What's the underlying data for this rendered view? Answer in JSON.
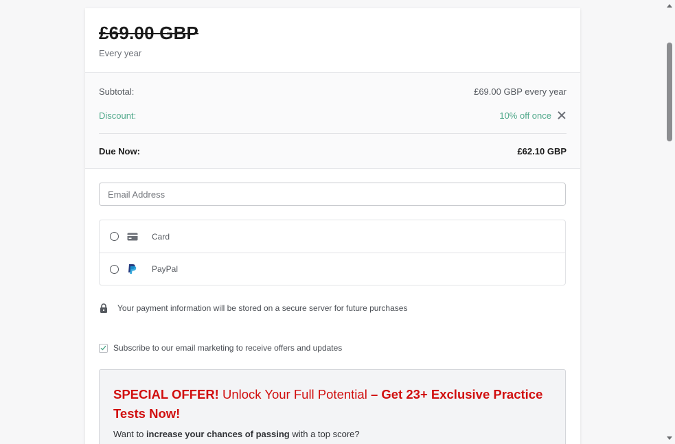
{
  "plan": {
    "old_price": "£69.00 GBP",
    "period": "Every year"
  },
  "summary": {
    "subtotal_label": "Subtotal:",
    "subtotal_value": "£69.00 GBP every year",
    "discount_label": "Discount:",
    "discount_value": "10% off once",
    "due_label": "Due Now:",
    "due_value": "£62.10 GBP"
  },
  "form": {
    "email_placeholder": "Email Address",
    "methods": [
      {
        "label": "Card",
        "icon": "card-icon"
      },
      {
        "label": "PayPal",
        "icon": "paypal-icon"
      }
    ],
    "secure_note": "Your payment information will be stored on a secure server for future purchases",
    "subscribe_label": "Subscribe to our email marketing to receive offers and updates",
    "subscribe_checked": true
  },
  "offer": {
    "title_bold_1": "SPECIAL OFFER!",
    "title_regular": " Unlock Your Full Potential ",
    "title_bold_2": "– Get 23+ Exclusive Practice Tests Now!",
    "sub_prefix": "Want to ",
    "sub_bold": "increase your chances of passing",
    "sub_suffix": " with a top score?"
  },
  "colors": {
    "discount": "#4fa88a",
    "offer_red": "#d10f0f"
  }
}
